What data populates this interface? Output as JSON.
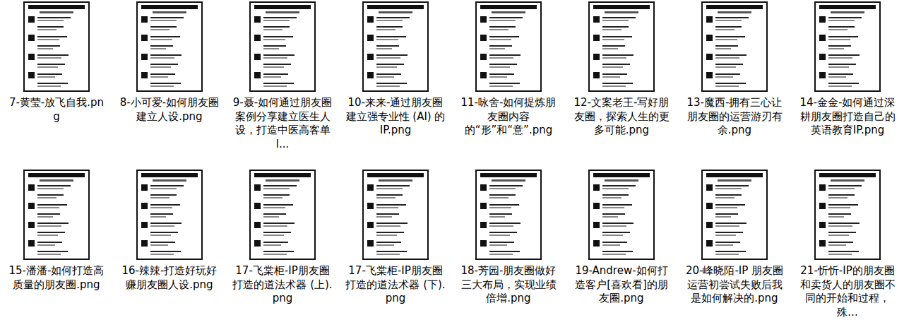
{
  "files": [
    {
      "name": "7-黄莹-放飞自我.png"
    },
    {
      "name": "8-小可爱-如何朋友圈建立人设.png"
    },
    {
      "name": "9-聂-如何通过朋友圈案例分享建立医生人设，打造中医高客单l..."
    },
    {
      "name": "10-来来-通过朋友圈建立强专业性 (AI) 的IP.png"
    },
    {
      "name": "11-咏舍-如何提炼朋友圈内容的“形”和“意”.png"
    },
    {
      "name": "12-文案老王-写好朋友圈，探索人生的更多可能.png"
    },
    {
      "name": "13-魔西-拥有三心让朋友圈的运营游刃有余.png"
    },
    {
      "name": "14-金金-如何通过深耕朋友圈打造自己的英语教育IP.png"
    },
    {
      "name": "15-潘潘-如何打造高质量的朋友圈.png"
    },
    {
      "name": "16-辣辣-打造好玩好赚朋友圈人设.png"
    },
    {
      "name": "17-飞棠柜-IP朋友圈打造的道法术器 (上).png"
    },
    {
      "name": "17-飞棠柜-IP朋友圈打造的道法术器 (下).png"
    },
    {
      "name": "18-芳园-朋友圈做好三大布局，实现业绩倍增.png"
    },
    {
      "name": "19-Andrew-如何打造客户[喜欢看]的朋友圈.png"
    },
    {
      "name": "20-峰晓陌-IP 朋友圈运营初尝试失败后我是如何解决的.png"
    },
    {
      "name": "21-忻忻-IP的朋友圈和卖货人的朋友圈不同的开始和过程，殊..."
    }
  ]
}
